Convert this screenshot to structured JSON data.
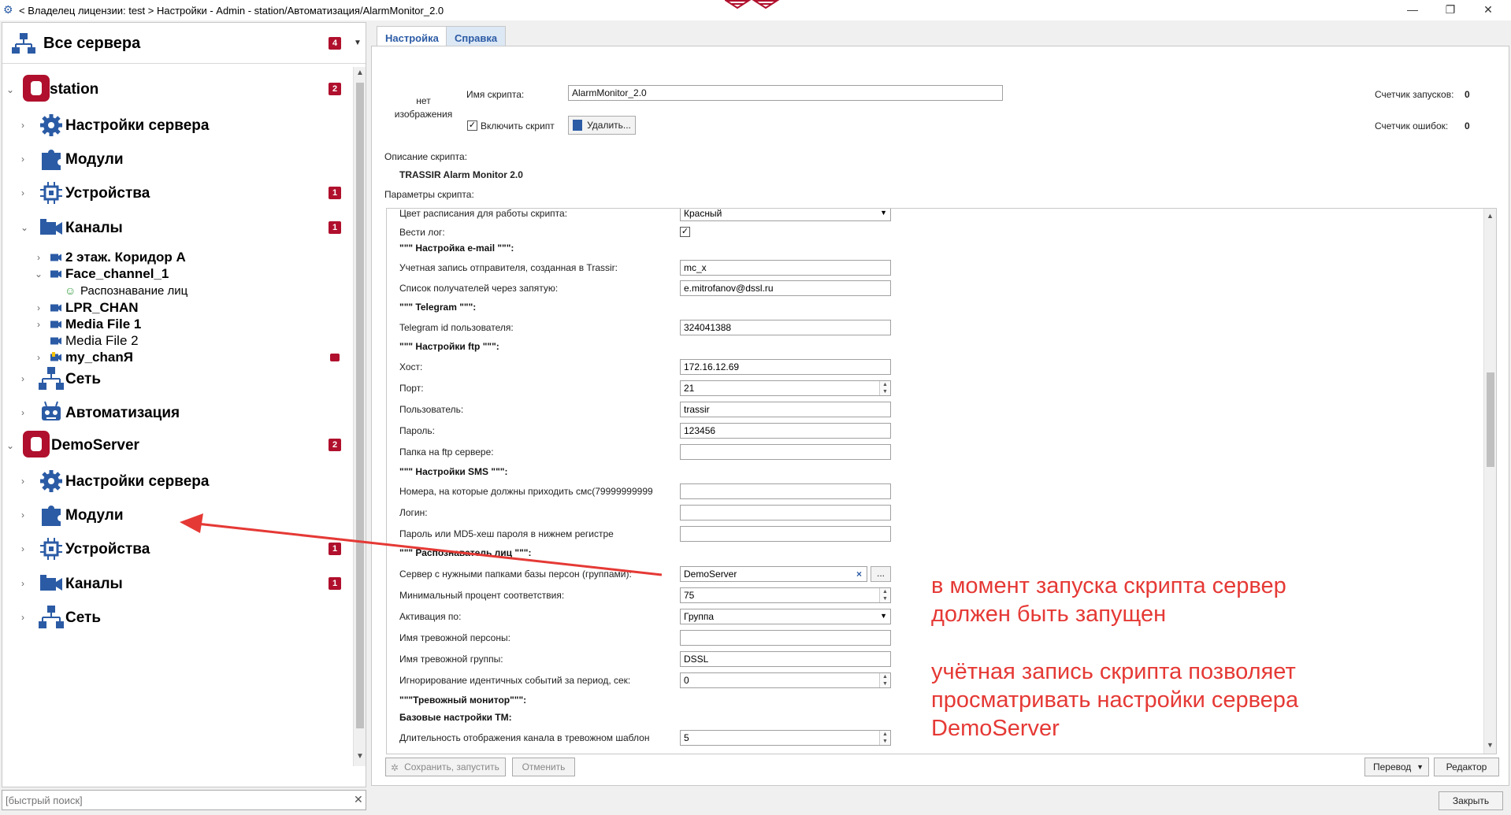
{
  "titlebar": {
    "text": "< Владелец лицензии: test > Настройки - Admin - station/Автоматизация/AlarmMonitor_2.0",
    "minimize": "—",
    "restore": "❐",
    "close": "✕"
  },
  "left": {
    "all_servers": {
      "label": "Все сервера",
      "badge": "4",
      "icon": "server-network-icon"
    },
    "tree": [
      {
        "label": "station",
        "badge": "2",
        "icon": "database-icon",
        "kind": "server"
      },
      {
        "label": "Настройки сервера",
        "icon": "gear-icon"
      },
      {
        "label": "Модули",
        "icon": "puzzle-icon"
      },
      {
        "label": "Устройства",
        "badge": "1",
        "icon": "chip-icon"
      },
      {
        "label": "Каналы",
        "badge": "1",
        "icon": "camera-icon"
      },
      {
        "label": "2 этаж. Коридор А",
        "icon": "camera-icon"
      },
      {
        "label": "Face_channel_1",
        "icon": "camera-icon"
      },
      {
        "label": "Распознавание лиц",
        "icon": "smiley-icon"
      },
      {
        "label": "LPR_CHAN",
        "icon": "camera-icon"
      },
      {
        "label": "Media File 1",
        "icon": "camera-icon"
      },
      {
        "label": "Media File 2",
        "icon": "camera-icon"
      },
      {
        "label": "my_chanЯ",
        "icon": "camera-warning-icon"
      },
      {
        "label": "Сеть",
        "icon": "network-icon"
      },
      {
        "label": "Автоматизация",
        "icon": "robot-icon"
      },
      {
        "label": "DemoServer",
        "badge": "2",
        "icon": "database-icon",
        "kind": "server"
      },
      {
        "label": "Настройки сервера",
        "icon": "gear-icon"
      },
      {
        "label": "Модули",
        "icon": "puzzle-icon"
      },
      {
        "label": "Устройства",
        "badge": "1",
        "icon": "chip-icon"
      },
      {
        "label": "Каналы",
        "badge": "1",
        "icon": "camera-icon"
      },
      {
        "label": "Сеть",
        "icon": "network-icon"
      }
    ],
    "search_placeholder": "[быстрый поиск]"
  },
  "tabs": [
    "Настройка",
    "Справка"
  ],
  "script": {
    "no_image": "нет изображения",
    "name_label": "Имя скрипта:",
    "name_value": "AlarmMonitor_2.0",
    "enable_label": "Включить скрипт",
    "delete_button": "Удалить...",
    "runs_label": "Счетчик запусков:",
    "runs_value": "0",
    "errors_label": "Счетчик ошибок:",
    "errors_value": "0",
    "desc_label": "Описание скрипта:",
    "desc_value": "TRASSIR Alarm Monitor 2.0",
    "params_label": "Параметры скрипта:"
  },
  "params": [
    {
      "label": "Цвет расписания для работы скрипта:",
      "value": "Красный",
      "type": "select"
    },
    {
      "label": "Вести лог:",
      "value": "✓",
      "type": "check"
    },
    {
      "label": "\"\"\" Настройка e-mail \"\"\":",
      "type": "header"
    },
    {
      "label": "Учетная запись отправителя, созданная в Trassir:",
      "value": "mc_x",
      "type": "text"
    },
    {
      "label": "Список получателей через запятую:",
      "value": "e.mitrofanov@dssl.ru",
      "type": "text"
    },
    {
      "label": "\"\"\" Telegram \"\"\":",
      "type": "header"
    },
    {
      "label": "Telegram id пользователя:",
      "value": "324041388",
      "type": "text"
    },
    {
      "label": "\"\"\" Настройки ftp \"\"\":",
      "type": "header"
    },
    {
      "label": "Хост:",
      "value": "172.16.12.69",
      "type": "text"
    },
    {
      "label": "Порт:",
      "value": "21",
      "type": "spin"
    },
    {
      "label": "Пользователь:",
      "value": "trassir",
      "type": "text"
    },
    {
      "label": "Пароль:",
      "value": "123456",
      "type": "text"
    },
    {
      "label": "Папка на ftp сервере:",
      "value": "",
      "type": "text"
    },
    {
      "label": "\"\"\" Настройки SMS \"\"\":",
      "type": "header"
    },
    {
      "label": "Номера, на которые должны приходить смс(79999999999",
      "value": "",
      "type": "text"
    },
    {
      "label": "Логин:",
      "value": "",
      "type": "text"
    },
    {
      "label": "Пароль или MD5-хеш пароля в нижнем регистре",
      "value": "",
      "type": "text"
    },
    {
      "label": "\"\"\" Распознаватель лиц \"\"\":",
      "type": "header"
    },
    {
      "label": "Сервер с нужными папками базы персон (группами):",
      "value": "DemoServer",
      "type": "server"
    },
    {
      "label": "Минимальный процент соответствия:",
      "value": "75",
      "type": "spin"
    },
    {
      "label": "Активация по:",
      "value": "Группа",
      "type": "select"
    },
    {
      "label": "Имя тревожной персоны:",
      "value": "",
      "type": "text"
    },
    {
      "label": "Имя тревожной группы:",
      "value": "DSSL",
      "type": "text"
    },
    {
      "label": "Игнорирование идентичных событий за период, сек:",
      "value": "0",
      "type": "spin"
    },
    {
      "label": "\"\"\"Тревожный монитор\"\"\":",
      "type": "header"
    },
    {
      "label": "Базовые настройки ТМ:",
      "type": "header"
    },
    {
      "label": "Длительность отображения канала в тревожном шаблон",
      "value": "5",
      "type": "spin"
    }
  ],
  "bottom": {
    "save": "Сохранить, запустить",
    "cancel": "Отменить",
    "translate": "Перевод",
    "editor": "Редактор",
    "close": "Закрыть"
  },
  "annotation": {
    "line1": "в момент запуска скрипта сервер",
    "line2": "должен быть запущен",
    "line3": "учётная запись скрипта позволяет",
    "line4": "просматривать настройки сервера",
    "line5": "DemoServer",
    "color": "#e53935"
  },
  "colors": {
    "accent": "#2b5ba5",
    "badge": "#b0102d"
  }
}
